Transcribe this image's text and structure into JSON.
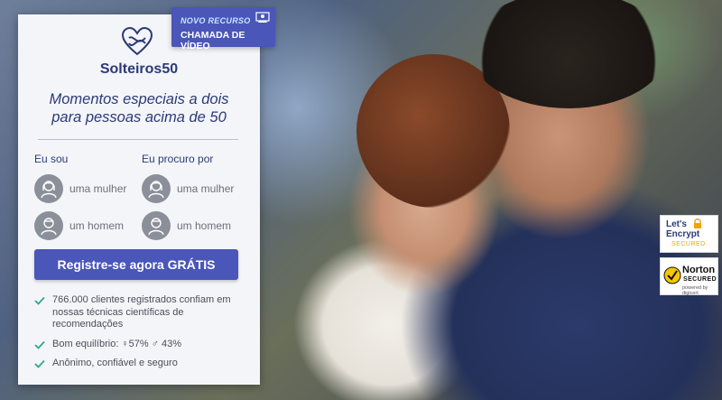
{
  "badge": {
    "line1": "NOVO RECURSO",
    "line2": "CHAMADA DE VÍDEO",
    "icon": "video-call-icon"
  },
  "brand": {
    "name": "Solteiros50",
    "icon": "heart-logo-icon"
  },
  "tagline": {
    "line1": "Momentos especiais a dois",
    "line2": "para pessoas acima de 50"
  },
  "form": {
    "i_am": {
      "heading": "Eu sou",
      "options": [
        {
          "label": "uma mulher"
        },
        {
          "label": "um homem"
        }
      ]
    },
    "seeking": {
      "heading": "Eu procuro por",
      "options": [
        {
          "label": "uma mulher"
        },
        {
          "label": "um homem"
        }
      ]
    },
    "cta_label": "Registre-se agora GRÁTIS"
  },
  "benefits": [
    "766.000 clientes registrados confiam em nossas técnicas científicas de recomendações",
    "Bom equilíbrio: ♀57% ♂ 43%",
    "Anônimo, confiável e seguro"
  ],
  "seals": {
    "letsencrypt": {
      "line1": "Let's",
      "line2": "Encrypt",
      "line3": "SECURED"
    },
    "norton": {
      "name": "Norton",
      "sub": "SECURED",
      "powered": "powered by digicert"
    }
  },
  "colors": {
    "primary": "#4a56b8",
    "brand_text": "#2b3a78",
    "check": "#2aa88f",
    "panel_bg": "#f4f5f9"
  }
}
